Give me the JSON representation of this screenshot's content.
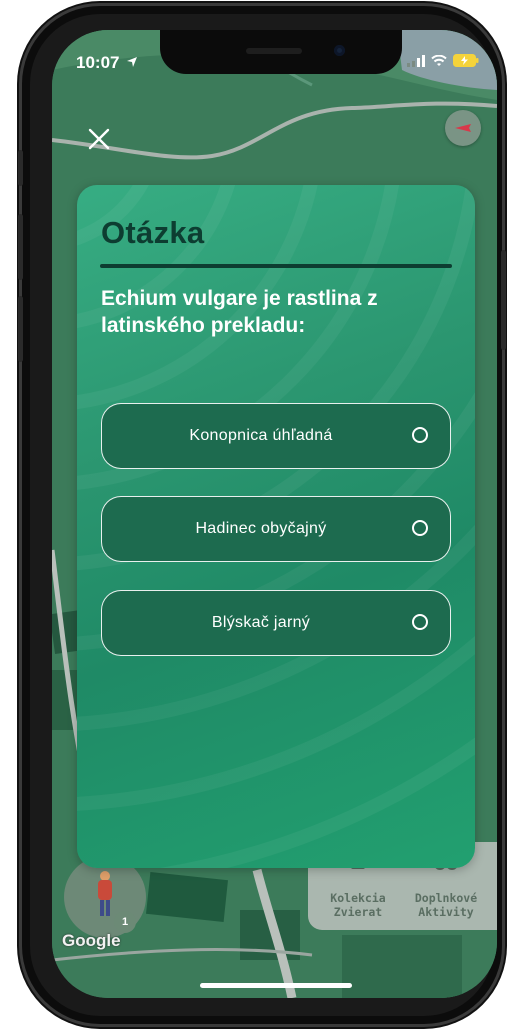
{
  "status_bar": {
    "time": "10:07",
    "icons": [
      "location-arrow-icon",
      "signal-icon",
      "wifi-icon",
      "battery-charging-icon"
    ]
  },
  "controls": {
    "close_icon": "close-icon",
    "compass_icon": "compass-icon"
  },
  "quiz": {
    "title": "Otázka",
    "question": "Echium vulgare je rastlina z latinského prekladu:",
    "answers": [
      {
        "label": "Konopnica úhľadná",
        "selected": false
      },
      {
        "label": "Hadinec obyčajný",
        "selected": false
      },
      {
        "label": "Blýskač jarný",
        "selected": false
      }
    ]
  },
  "map_ui": {
    "avatar_badge": "1",
    "collection_button": {
      "label_line1": "Kolekcia",
      "label_line2": "Zvierat",
      "icon": "collection-icon"
    },
    "activities_button": {
      "label_line1": "Doplnkové",
      "label_line2": "Aktivity",
      "icon": "binoculars-icon"
    },
    "map_attribution": "Google"
  },
  "colors": {
    "card_gradient_start": "#37ad83",
    "card_gradient_end": "#1f8a66",
    "title_color": "#0d3d31",
    "answer_bg": "#1d6b4f",
    "map_green": "#3b7a59"
  }
}
